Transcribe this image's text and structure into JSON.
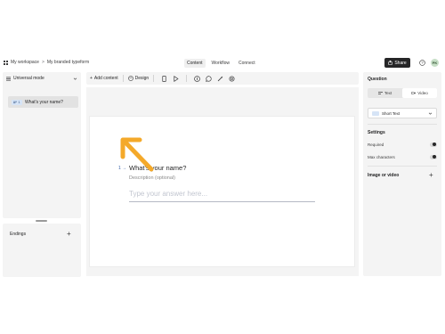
{
  "header": {
    "breadcrumb_workspace": "My workspace",
    "breadcrumb_sep": ">",
    "breadcrumb_form": "My branded typeform",
    "tabs": [
      {
        "label": "Content",
        "active": true
      },
      {
        "label": "Workflow",
        "active": false
      },
      {
        "label": "Connect",
        "active": false
      }
    ],
    "share_label": "Share",
    "avatar_initials": "PK"
  },
  "left": {
    "mode_label": "Universal mode",
    "questions": [
      {
        "number": "1",
        "label": "What's your name?"
      }
    ],
    "endings_label": "Endings",
    "add_symbol": "+"
  },
  "toolbar": {
    "add_content_label": "Add content",
    "add_symbol": "+",
    "design_label": "Design"
  },
  "canvas": {
    "question_number": "1 →",
    "question_title": "What's your name?",
    "description_placeholder": "Description (optional)",
    "answer_placeholder": "Type your answer here..."
  },
  "right": {
    "question_heading": "Question",
    "text_tab": "Text",
    "video_tab": "Video",
    "type_value": "Short Text",
    "settings_heading": "Settings",
    "required_label": "Required",
    "max_chars_label": "Max characters",
    "image_video_label": "Image or video",
    "add_symbol": "+"
  },
  "colors": {
    "accent_arrow": "#f4a92a",
    "share_bg": "#262627",
    "panel_bg": "#f4f4f4"
  }
}
